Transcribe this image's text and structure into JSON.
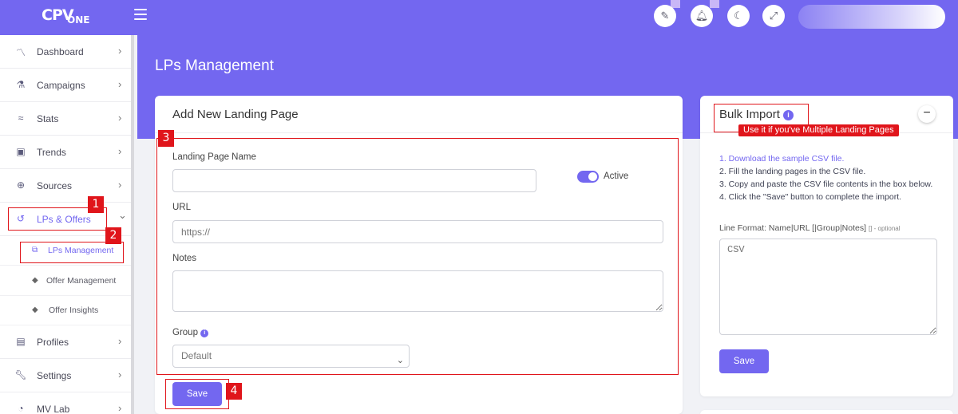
{
  "app": {
    "logo_main": "CPV",
    "logo_sub": "ONE"
  },
  "topbar": {
    "icons": [
      "magic-wand-icon",
      "bell-icon",
      "moon-icon",
      "expand-icon"
    ],
    "glyphs": {
      "wand": "✎",
      "bell": "🔔︎",
      "moon": "☾",
      "expand": "⤢"
    }
  },
  "sidebar": {
    "items": [
      {
        "label": "Dashboard",
        "icon": "chart-line-icon",
        "glyph": "〽"
      },
      {
        "label": "Campaigns",
        "icon": "flask-icon",
        "glyph": "⚗"
      },
      {
        "label": "Stats",
        "icon": "stats-icon",
        "glyph": "≈"
      },
      {
        "label": "Trends",
        "icon": "briefcase-icon",
        "glyph": "▣"
      },
      {
        "label": "Sources",
        "icon": "globe-icon",
        "glyph": "⊕"
      },
      {
        "label": "LPs & Offers",
        "icon": "history-icon",
        "glyph": "↺"
      },
      {
        "label": "Profiles",
        "icon": "clipboard-icon",
        "glyph": "▤"
      },
      {
        "label": "Settings",
        "icon": "wrench-icon",
        "glyph": "🔧︎"
      },
      {
        "label": "MV Lab",
        "icon": "lab-icon",
        "glyph": "◔"
      }
    ],
    "sub_items": [
      {
        "label": "LPs Management",
        "icon": "copy-icon",
        "glyph": "⧉"
      },
      {
        "label": "Offer Management",
        "icon": "tag-icon",
        "glyph": "◆"
      },
      {
        "label": "Offer Insights",
        "icon": "tags-icon",
        "glyph": "◆"
      }
    ],
    "chevron_right": "›",
    "chevron_down": "⌄"
  },
  "page": {
    "title": "LPs Management"
  },
  "add_form": {
    "title": "Add New Landing Page",
    "name_label": "Landing Page Name",
    "name_value": "",
    "active_label": "Active",
    "active": true,
    "url_label": "URL",
    "url_placeholder": "https://",
    "notes_label": "Notes",
    "notes_value": "",
    "group_label": "Group",
    "group_selected": "Default",
    "save_label": "Save"
  },
  "bulk_import": {
    "title": "Bulk Import",
    "info_glyph": "i",
    "collapse_glyph": "−",
    "callout": "Use it if you've Multiple Landing Pages",
    "step1": "1. Download the sample CSV file.",
    "step2": "2. Fill the landing pages in the CSV file.",
    "step3": "3. Copy and paste the CSV file contents in the box below.",
    "step4": "4. Click the \"Save\" button to complete the import.",
    "line_format": "Line Format: Name|URL [|Group|Notes]",
    "line_format_optional": "[] - optional",
    "csv_placeholder": "CSV",
    "save_label": "Save"
  },
  "annotations": [
    "1",
    "2",
    "3",
    "4"
  ],
  "colors": {
    "accent": "#7367f0",
    "annotation": "#e0151b"
  }
}
